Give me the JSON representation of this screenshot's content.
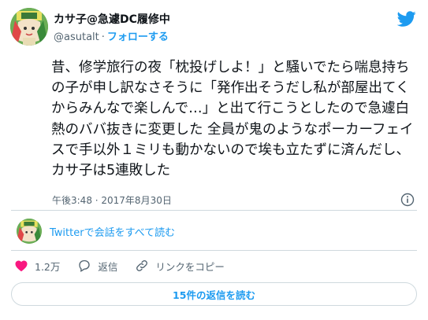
{
  "author": {
    "display_name": "カサ子@急遽DC履修中",
    "handle": "@asutalt",
    "separator": "·",
    "follow_label": "フォローする"
  },
  "tweet": {
    "text": "昔、修学旅行の夜「枕投げしよ！」と騒いでたら喘息持ちの子が申し訳なさそうに「発作出そうだし私が部屋出てくからみんなで楽しんで…」と出て行こうとしたので急遽白熱のババ抜きに変更した 全員が鬼のようなポーカーフェイスで手以外１ミリも動かないので埃も立たずに済んだし、カサ子は5連敗した",
    "timestamp": "午後3:48 · 2017年8月30日"
  },
  "conversation_link": "Twitterで会話をすべて読む",
  "actions": {
    "like_count": "1.2万",
    "reply_label": "返信",
    "copy_link_label": "リンクをコピー"
  },
  "replies_button": "15件の返信を読む",
  "colors": {
    "accent": "#1d9bf0",
    "like_red": "#f91880",
    "secondary_text": "#536471",
    "border": "#cfd9de"
  },
  "icons": {
    "brand": "twitter-bird-icon",
    "info": "info-icon",
    "like": "heart-icon",
    "reply": "speech-bubble-icon",
    "copy_link": "link-icon"
  }
}
